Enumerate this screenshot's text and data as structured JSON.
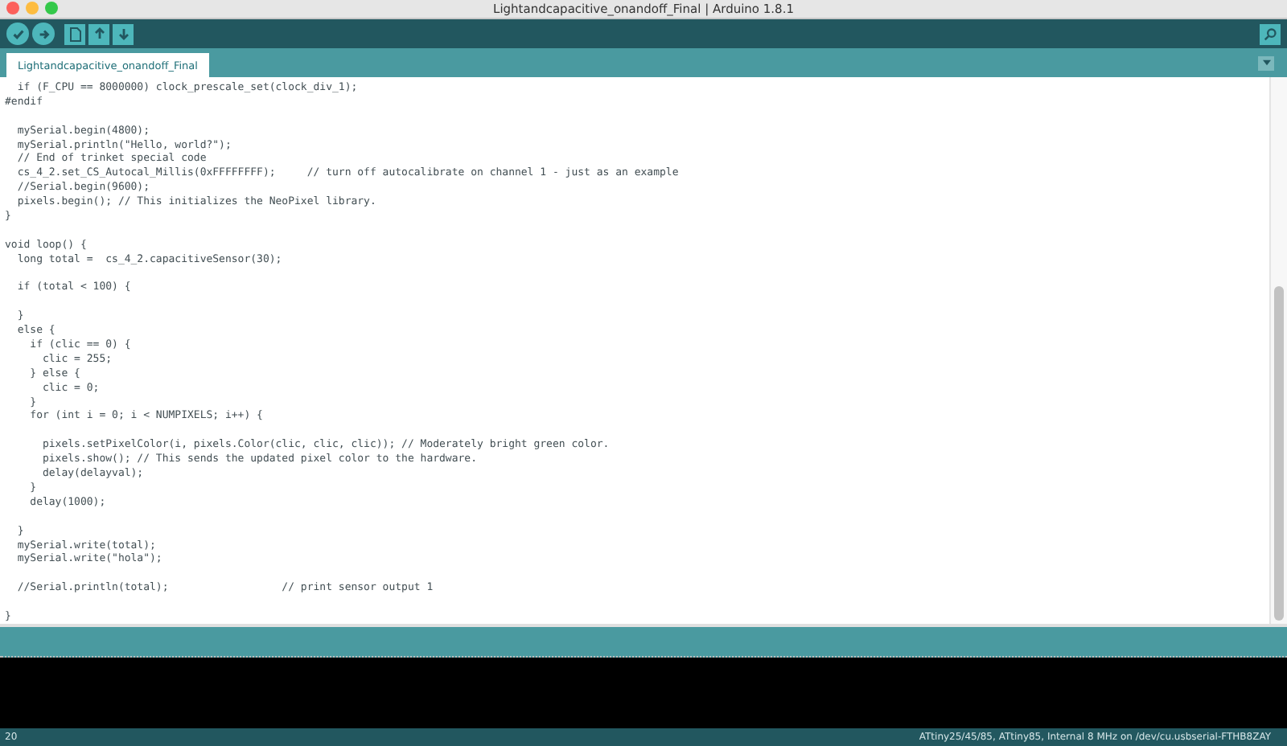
{
  "window": {
    "title": "Lightandcapacitive_onandoff_Final | Arduino 1.8.1"
  },
  "tabs": [
    {
      "label": "Lightandcapacitive_onandoff_Final",
      "selected": true
    }
  ],
  "editor": {
    "blocks": [
      [
        "  if (F_CPU == 8000000) clock_prescale_set(clock_div_1);",
        "#endif"
      ],
      [
        "  mySerial.begin(4800);",
        "  mySerial.println(\"Hello, world?\");",
        "  // End of trinket special code",
        "  cs_4_2.set_CS_Autocal_Millis(0xFFFFFFFF);     // turn off autocalibrate on channel 1 - just as an example",
        "  //Serial.begin(9600);",
        "  pixels.begin(); // This initializes the NeoPixel library.",
        "}"
      ],
      [
        "void loop() {",
        "  long total =  cs_4_2.capacitiveSensor(30);"
      ],
      [
        "  if (total < 100) {"
      ],
      [
        "  }",
        "  else {",
        "    if (clic == 0) {",
        "      clic = 255;",
        "    } else {",
        "      clic = 0;",
        "    }",
        "    for (int i = 0; i < NUMPIXELS; i++) {"
      ],
      [
        "      pixels.setPixelColor(i, pixels.Color(clic, clic, clic)); // Moderately bright green color.",
        "      pixels.show(); // This sends the updated pixel color to the hardware.",
        "      delay(delayval);",
        "    }",
        "    delay(1000);"
      ],
      [
        "  }",
        "  mySerial.write(total);",
        "  mySerial.write(\"hola\");"
      ],
      [
        "  //Serial.println(total);                  // print sensor output 1"
      ],
      [
        "}"
      ]
    ]
  },
  "status_bar": {
    "line": "20",
    "board": "ATtiny25/45/85, ATtiny85, Internal 8 MHz on /dev/cu.usbserial-FTHB8ZAY"
  }
}
